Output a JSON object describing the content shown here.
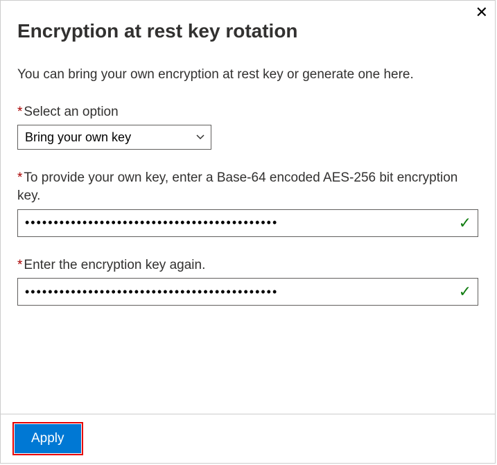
{
  "dialog": {
    "title": "Encryption at rest key rotation",
    "description": "You can bring your own encryption at rest key or generate one here."
  },
  "select_option": {
    "label": "Select an option",
    "value": "Bring your own key"
  },
  "key_field": {
    "label": "To provide your own key, enter a Base-64 encoded AES-256 bit encryption key.",
    "value": "••••••••••••••••••••••••••••••••••••••••••••"
  },
  "key_confirm_field": {
    "label": "Enter the encryption key again.",
    "value": "••••••••••••••••••••••••••••••••••••••••••••"
  },
  "footer": {
    "apply_label": "Apply"
  },
  "icons": {
    "close": "✕",
    "required": "*",
    "checkmark": "✓"
  }
}
